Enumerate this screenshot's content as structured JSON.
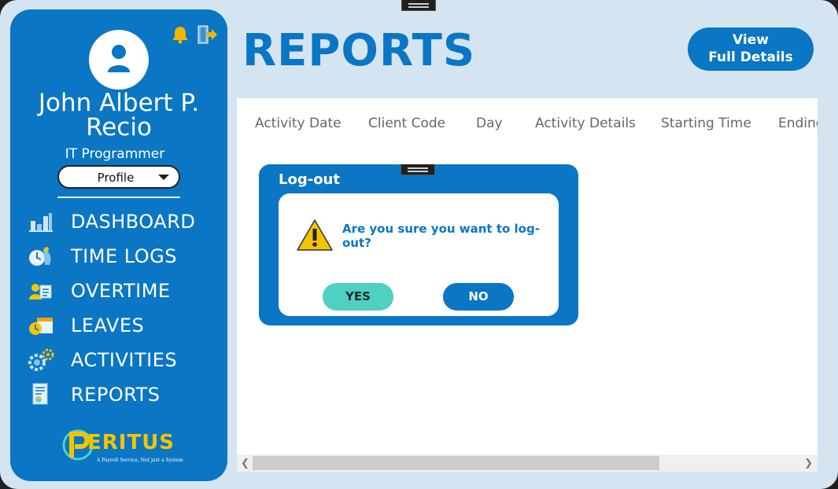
{
  "user": {
    "name_line1": "John Albert P.",
    "name_line2": "Recio",
    "role": "IT Programmer",
    "profile_label": "Profile"
  },
  "icons": {
    "avatar": "user-icon",
    "notifications": "bell-icon",
    "logout": "logout-icon"
  },
  "nav": {
    "items": [
      {
        "label": "DASHBOARD",
        "icon": "dashboard-chart-icon"
      },
      {
        "label": "TIME LOGS",
        "icon": "time-logs-icon"
      },
      {
        "label": "OVERTIME",
        "icon": "overtime-icon"
      },
      {
        "label": "LEAVES",
        "icon": "leaves-calendar-icon"
      },
      {
        "label": "ACTIVITIES",
        "icon": "activities-gear-icon"
      },
      {
        "label": "REPORTS",
        "icon": "reports-document-icon"
      }
    ]
  },
  "brand": {
    "name": "ERITUS",
    "tagline": "A Payroll Service, Not just a System"
  },
  "header": {
    "title": "REPORTS",
    "view_line1": "View",
    "view_line2": "Full Details"
  },
  "table": {
    "columns": [
      "Activity Date",
      "Client Code",
      "Day",
      "Activity Details",
      "Starting Time",
      "Ending"
    ]
  },
  "dialog": {
    "title": "Log-out",
    "message_line1": "Are you sure you want to log-",
    "message_line2": "out?",
    "yes_label": "YES",
    "no_label": "NO"
  },
  "colors": {
    "primary": "#0a76c4",
    "background": "#d4e4f1",
    "yes_button": "#4fd1c1",
    "brand_gold": "#f5c400"
  }
}
